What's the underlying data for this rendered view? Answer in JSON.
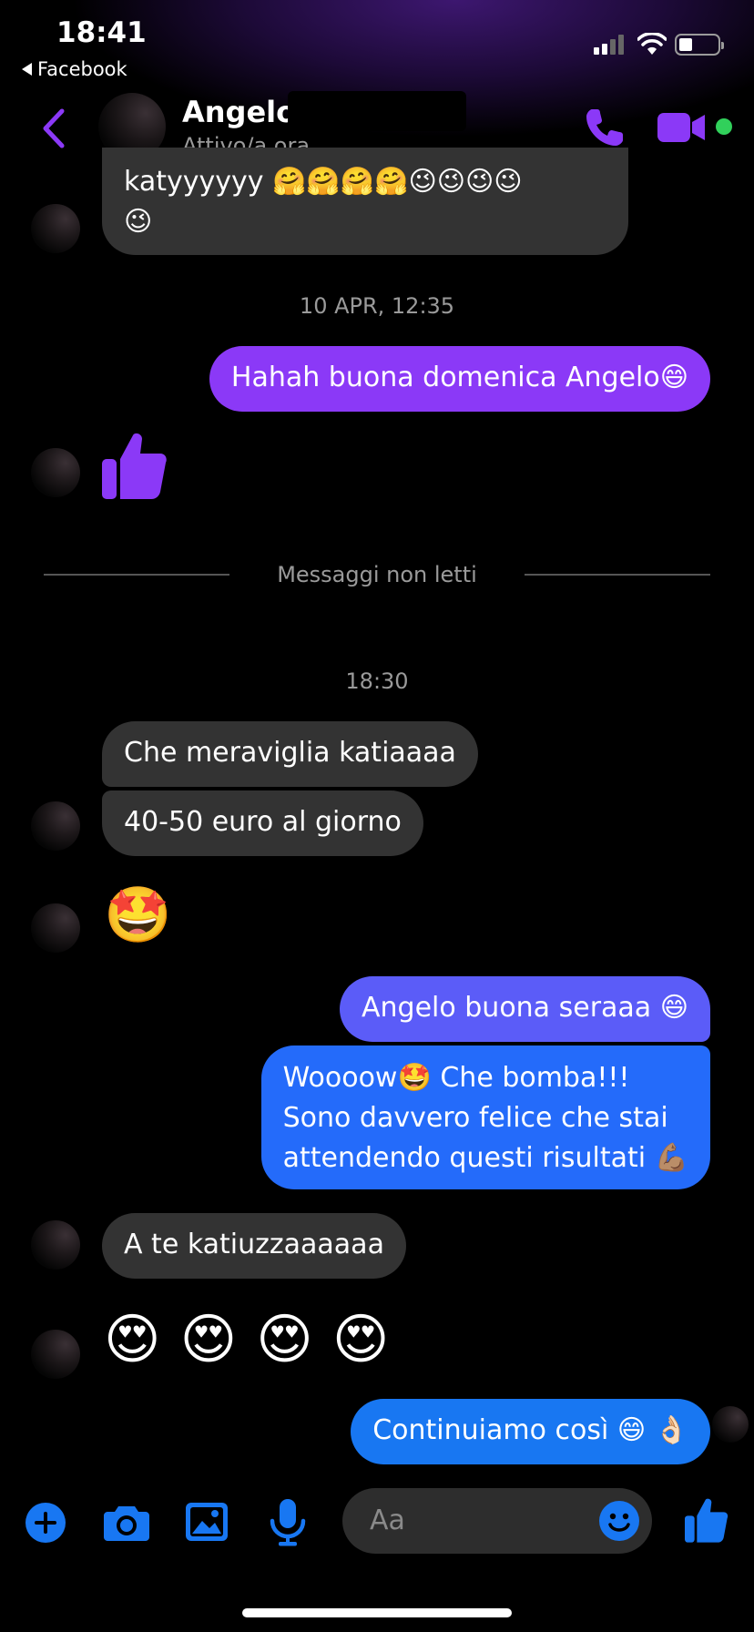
{
  "status_bar": {
    "time": "18:41",
    "back_app": "Facebook"
  },
  "header": {
    "contact_name": "Angelo Be",
    "contact_status": "Attivo/a ora"
  },
  "messages": {
    "m1": "katyyyyyy 🤗🤗🤗🤗😉😉😉😉",
    "m1b": "😉",
    "ts1": "10 APR, 12:35",
    "m2": "Hahah buona domenica Angelo😄",
    "unread_label": "Messaggi non letti",
    "ts2": "18:30",
    "m3": "Che meraviglia katiaaaa",
    "m4": "40-50 euro al giorno",
    "m5": "🤩",
    "m6": "Angelo buona seraaa 😄",
    "m7_line1": "Woooow🤩 Che bomba!!!",
    "m7_line2": "Sono davvero felice che stai",
    "m7_line3": "attendendo questi risultati 💪🏽",
    "m8": "A te katiuzzaaaaaa",
    "m9": "😍 😍 😍 😍",
    "m10": "Continuiamo così 😄 👌🏻"
  },
  "composer": {
    "placeholder": "Aa"
  },
  "colors": {
    "accent_purple": "#8b39f7",
    "accent_blue": "#1877f2",
    "incoming_bubble": "#333333",
    "online": "#31d05b"
  },
  "icons": {
    "header": [
      "chevron-left-icon",
      "phone-icon",
      "video-camera-icon"
    ],
    "composer": [
      "plus-circle-icon",
      "camera-icon",
      "image-icon",
      "microphone-icon",
      "emoji-icon",
      "thumbs-up-icon"
    ]
  }
}
